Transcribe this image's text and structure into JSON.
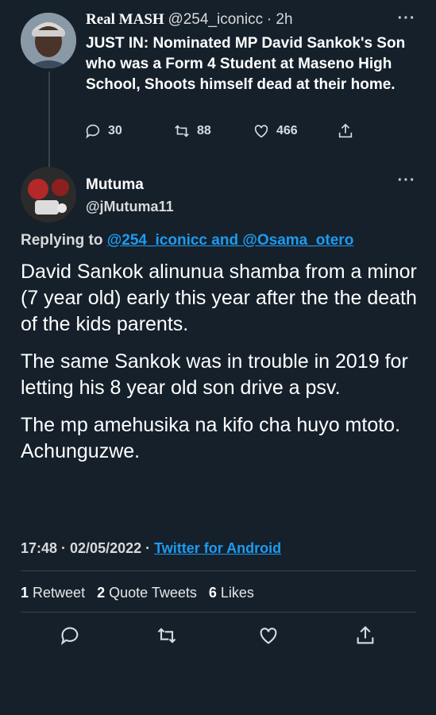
{
  "tweet1": {
    "name": "Real MASH",
    "handle": "@254_iconicc",
    "time": "· 2h",
    "text": "JUST IN: Nominated MP David Sankok's Son who was a Form 4 Student at Maseno High School, Shoots himself dead at their home.",
    "replies": "30",
    "retweets": "88",
    "likes": "466"
  },
  "tweet2": {
    "name": "Mutuma",
    "handle": "@jMutuma11",
    "replying_prefix": "Replying to ",
    "replying_to": "@254_iconicc and @Osama_otero",
    "paragraphs": [
      "David Sankok  alinunua shamba from a minor (7 year old) early this year after the the death of the kids parents.",
      "The same Sankok was in trouble in 2019 for letting his  8 year old  son drive a psv.",
      "The mp amehusika na kifo cha huyo mtoto. Achunguzwe."
    ],
    "timestamp": "17:48 · 02/05/2022 · ",
    "client": "Twitter for Android",
    "stats": {
      "retweets_count": "1",
      "retweets_label": "Retweet",
      "quotes_count": "2",
      "quotes_label": "Quote Tweets",
      "likes_count": "6",
      "likes_label": "Likes"
    }
  },
  "icons": [
    "more-icon",
    "reply-icon",
    "retweet-icon",
    "like-icon",
    "share-icon"
  ],
  "colors": {
    "background": "#15202b",
    "link": "#1d9bf0",
    "divider": "#38444d"
  }
}
